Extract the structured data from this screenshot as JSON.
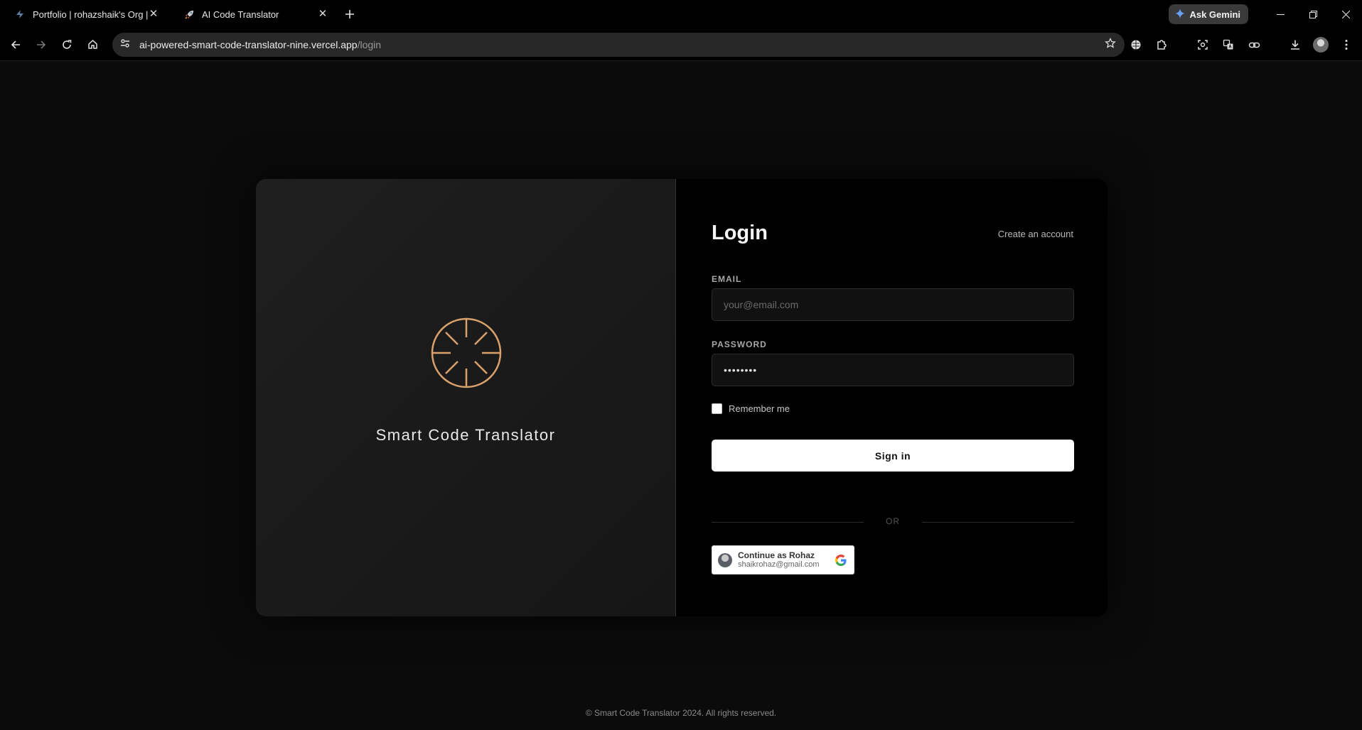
{
  "browser": {
    "tabs": [
      {
        "title": "Portfolio | rohazshaik's Org | Su",
        "favicon": "supabase-bolt-icon"
      },
      {
        "title": "AI Code Translator",
        "favicon": "rocket-icon"
      }
    ],
    "ask_gemini": "Ask Gemini",
    "url_host": "ai-powered-smart-code-translator-nine.vercel.app",
    "url_path": "/login"
  },
  "brand": {
    "name": "Smart Code Translator",
    "logo_color": "#d9a06b"
  },
  "login": {
    "title": "Login",
    "create_account": "Create an account",
    "email_label": "EMAIL",
    "email_placeholder": "your@email.com",
    "password_label": "PASSWORD",
    "password_value": "••••••••",
    "remember_me": "Remember me",
    "sign_in": "Sign in",
    "or": "OR"
  },
  "google": {
    "title": "Continue as Rohaz",
    "email": "shaikrohaz@gmail.com"
  },
  "footer": {
    "text": "© Smart Code Translator 2024. All rights reserved."
  }
}
